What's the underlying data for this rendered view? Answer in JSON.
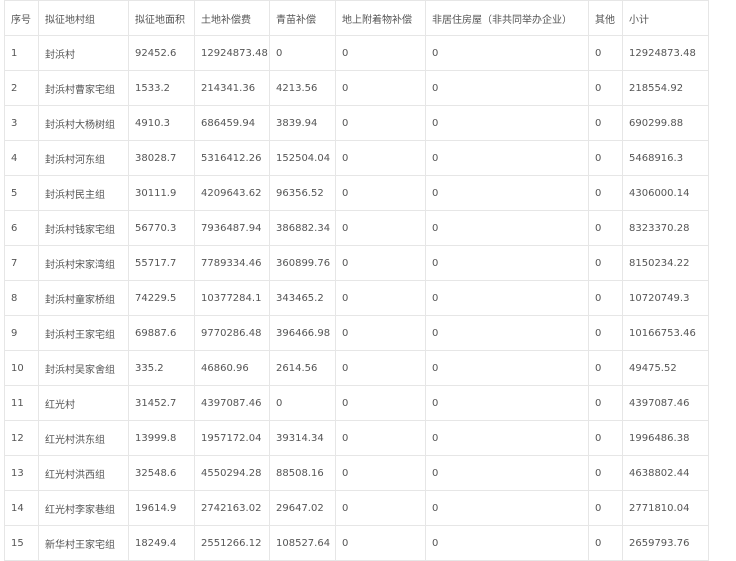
{
  "table": {
    "headers": [
      "序号",
      "拟征地村组",
      "拟征地面积",
      "土地补偿费",
      "青苗补偿",
      "地上附着物补偿",
      "非居住房屋（非共同举办企业）",
      "其他",
      "小计"
    ],
    "rows": [
      [
        "1",
        "封浜村",
        "92452.6",
        "12924873.48",
        "0",
        "0",
        "0",
        "0",
        "12924873.48"
      ],
      [
        "2",
        "封浜村曹家宅组",
        "1533.2",
        "214341.36",
        "4213.56",
        "0",
        "0",
        "0",
        "218554.92"
      ],
      [
        "3",
        "封浜村大杨树组",
        "4910.3",
        "686459.94",
        "3839.94",
        "0",
        "0",
        "0",
        "690299.88"
      ],
      [
        "4",
        "封浜村河东组",
        "38028.7",
        "5316412.26",
        "152504.04",
        "0",
        "0",
        "0",
        "5468916.3"
      ],
      [
        "5",
        "封浜村民主组",
        "30111.9",
        "4209643.62",
        "96356.52",
        "0",
        "0",
        "0",
        "4306000.14"
      ],
      [
        "6",
        "封浜村钱家宅组",
        "56770.3",
        "7936487.94",
        "386882.34",
        "0",
        "0",
        "0",
        "8323370.28"
      ],
      [
        "7",
        "封浜村宋家湾组",
        "55717.7",
        "7789334.46",
        "360899.76",
        "0",
        "0",
        "0",
        "8150234.22"
      ],
      [
        "8",
        "封浜村童家桥组",
        "74229.5",
        "10377284.1",
        "343465.2",
        "0",
        "0",
        "0",
        "10720749.3"
      ],
      [
        "9",
        "封浜村王家宅组",
        "69887.6",
        "9770286.48",
        "396466.98",
        "0",
        "0",
        "0",
        "10166753.46"
      ],
      [
        "10",
        "封浜村吴家舍组",
        "335.2",
        "46860.96",
        "2614.56",
        "0",
        "0",
        "0",
        "49475.52"
      ],
      [
        "11",
        "红光村",
        "31452.7",
        "4397087.46",
        "0",
        "0",
        "0",
        "0",
        "4397087.46"
      ],
      [
        "12",
        "红光村洪东组",
        "13999.8",
        "1957172.04",
        "39314.34",
        "0",
        "0",
        "0",
        "1996486.38"
      ],
      [
        "13",
        "红光村洪西组",
        "32548.6",
        "4550294.28",
        "88508.16",
        "0",
        "0",
        "0",
        "4638802.44"
      ],
      [
        "14",
        "红光村李家巷组",
        "19614.9",
        "2742163.02",
        "29647.02",
        "0",
        "0",
        "0",
        "2771810.04"
      ],
      [
        "15",
        "新华村王家宅组",
        "18249.4",
        "2551266.12",
        "108527.64",
        "0",
        "0",
        "0",
        "2659793.76"
      ]
    ]
  }
}
